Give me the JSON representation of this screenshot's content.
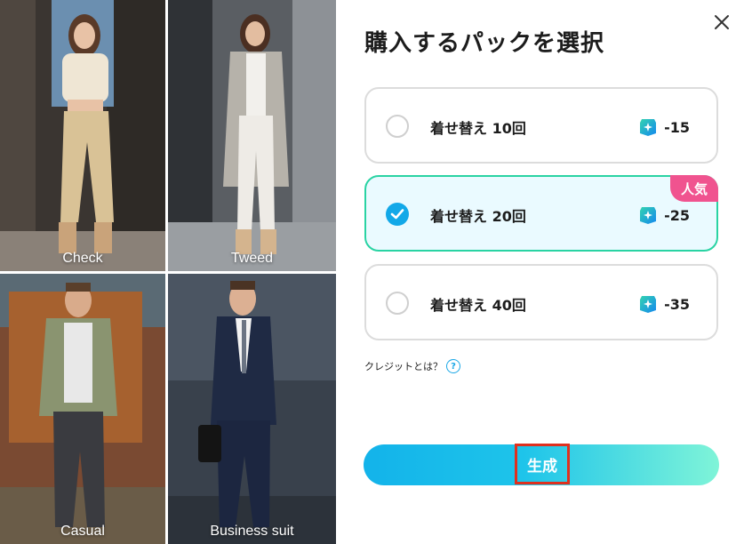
{
  "gallery": {
    "tiles": [
      {
        "caption": "Check"
      },
      {
        "caption": "Tweed"
      },
      {
        "caption": "Casual"
      },
      {
        "caption": "Business suit"
      }
    ]
  },
  "dialog": {
    "title": "購入するパックを選択",
    "options": [
      {
        "label": "着せ替え 10回",
        "credits": "-15",
        "selected": false
      },
      {
        "label": "着せ替え 20回",
        "credits": "-25",
        "selected": true,
        "badge": "人気"
      },
      {
        "label": "着せ替え 40回",
        "credits": "-35",
        "selected": false
      }
    ],
    "credit_help": "クレジットとは？",
    "help_icon": "?",
    "generate_label": "生成"
  },
  "icons": {
    "close": "close-icon",
    "credit": "credit-gem-icon",
    "check": "check-icon",
    "help": "question-icon"
  },
  "colors": {
    "selected_border": "#29d3a3",
    "selected_bg": "#eafaff",
    "badge": "#f0538f",
    "radio_checked": "#12a8e8",
    "button_gradient_start": "#13b3ea",
    "button_gradient_end": "#7ff4d8",
    "highlight": "#e0301e"
  }
}
